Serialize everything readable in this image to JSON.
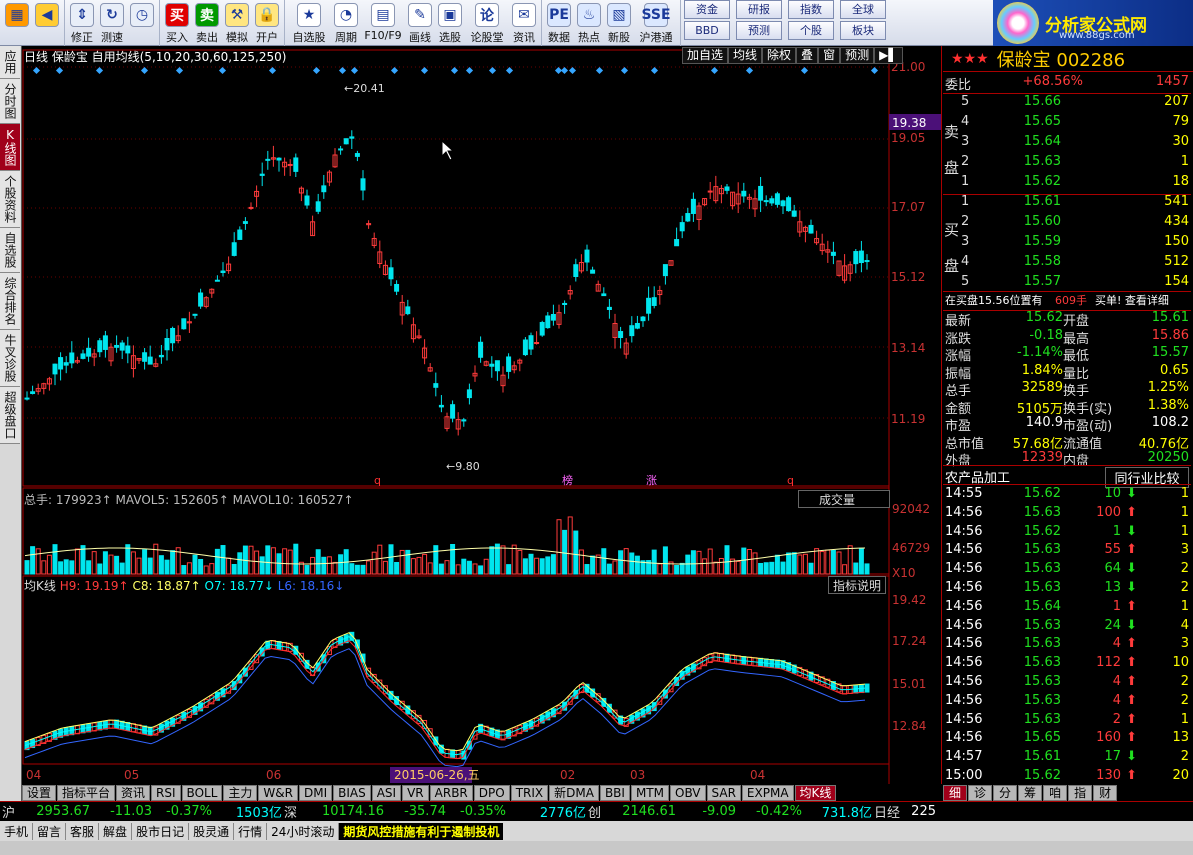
{
  "toolbar": {
    "groups": [
      [
        {
          "label": "",
          "icon": "grid-icon",
          "color": "#ff9900"
        },
        {
          "label": "",
          "icon": "back-arrow-icon",
          "color": "#ffcc33"
        }
      ],
      [
        {
          "label": "修正",
          "icon": "up-down-icon"
        },
        {
          "label": "测速",
          "icon": "refresh-icon"
        },
        {
          "label": "",
          "icon": "clock-icon"
        }
      ],
      [
        {
          "label": "买入",
          "icon": "buy-icon",
          "glyph": "买",
          "color": "#e00000"
        },
        {
          "label": "卖出",
          "icon": "sell-icon",
          "glyph": "卖",
          "color": "#009900"
        },
        {
          "label": "模拟",
          "icon": "hammer-icon"
        },
        {
          "label": "开户",
          "icon": "lock-icon"
        }
      ],
      [
        {
          "label": "自选股",
          "icon": "star-icon"
        },
        {
          "label": "周期",
          "icon": "cycle-icon"
        },
        {
          "label": "F10/F9",
          "icon": "f10-icon"
        },
        {
          "label": "画线",
          "icon": "pen-icon"
        },
        {
          "label": "选股",
          "icon": "select-icon"
        },
        {
          "label": "论股堂",
          "icon": "discuss-icon",
          "glyph": "论"
        },
        {
          "label": "资讯",
          "icon": "news-icon"
        }
      ],
      [
        {
          "label": "数据",
          "icon": "pe-icon",
          "glyph": "PE"
        },
        {
          "label": "热点",
          "icon": "hot-icon"
        },
        {
          "label": "新股",
          "icon": "new-stock-icon"
        },
        {
          "label": "沪港通",
          "icon": "shhk-icon",
          "glyph": "SSE"
        }
      ]
    ],
    "pairs": [
      [
        "资金",
        "BBD"
      ],
      [
        "研报",
        "预测"
      ],
      [
        "指数",
        "个股"
      ],
      [
        "全球",
        "板块"
      ]
    ],
    "logo_text": "分析家公式网",
    "logo_url": "www.88gs.com"
  },
  "sidetabs": [
    {
      "label": "应用",
      "active": false
    },
    {
      "label": "分时图",
      "active": false
    },
    {
      "label": "K线图",
      "active": true
    },
    {
      "label": "个股资料",
      "active": false
    },
    {
      "label": "自选股",
      "active": false
    },
    {
      "label": "综合排名",
      "active": false
    },
    {
      "label": "牛叉诊股",
      "active": false
    },
    {
      "label": "超级盘口",
      "active": false
    }
  ],
  "chart": {
    "title": "日线  保龄宝 自用均线(5,10,20,30,60,125,250)",
    "menu": [
      "加自选",
      "均线",
      "除权",
      "叠",
      "窗",
      "预测",
      "▶▌"
    ],
    "price_labels": [
      "21.00",
      "19.05",
      "17.07",
      "15.12",
      "13.14",
      "11.19"
    ],
    "current_price_label": "19.38",
    "high_label": "20.41",
    "low_label": "9.80",
    "markers": [
      "q",
      "榜",
      "涨",
      "q"
    ],
    "volume_title": "总手: 179923↑  MAVOL5: 152605↑  MAVOL10: 160527↑",
    "volume_select": "成交量",
    "volume_labels": [
      "92042",
      "46729"
    ],
    "volume_unit": "X10",
    "indicator_title_parts": [
      {
        "text": "均K线 ",
        "color": "#dddddd"
      },
      {
        "text": "H9: 19.19↑ ",
        "color": "#ff3b3b"
      },
      {
        "text": "C8: 18.87↑ ",
        "color": "#ffff66"
      },
      {
        "text": "O7: 18.77↓ ",
        "color": "#00ffff"
      },
      {
        "text": "L6: 18.16↓",
        "color": "#3366ff"
      }
    ],
    "indicator_button": "指标说明",
    "indicator_labels": [
      "19.42",
      "17.24",
      "15.01",
      "12.84"
    ],
    "date_labels": [
      "04",
      "05",
      "06",
      "2015-06-26,五",
      "02",
      "03",
      "04"
    ]
  },
  "bottom_tabs": [
    "设置",
    "指标平台",
    "资讯",
    "RSI",
    "BOLL",
    "主力",
    "W&R",
    "DMI",
    "BIAS",
    "ASI",
    "VR",
    "ARBR",
    "DPO",
    "TRIX",
    "新DMA",
    "BBI",
    "MTM",
    "OBV",
    "SAR",
    "EXPMA",
    "均K线"
  ],
  "bottom_tab_active": "均K线",
  "quote": {
    "stock_name": "保龄宝 002286",
    "weibi": {
      "label": "委比",
      "pct": "+68.56%",
      "val": "1457"
    },
    "sell": [
      {
        "lvl": "5",
        "price": "15.66",
        "vol": "207"
      },
      {
        "lvl": "4",
        "price": "15.65",
        "vol": "79"
      },
      {
        "lvl": "3",
        "price": "15.64",
        "vol": "30"
      },
      {
        "lvl": "2",
        "price": "15.63",
        "vol": "1"
      },
      {
        "lvl": "1",
        "price": "15.62",
        "vol": "18"
      }
    ],
    "buy": [
      {
        "lvl": "1",
        "price": "15.61",
        "vol": "541"
      },
      {
        "lvl": "2",
        "price": "15.60",
        "vol": "434"
      },
      {
        "lvl": "3",
        "price": "15.59",
        "vol": "150"
      },
      {
        "lvl": "4",
        "price": "15.58",
        "vol": "512"
      },
      {
        "lvl": "5",
        "price": "15.57",
        "vol": "154"
      }
    ],
    "sell_label": "卖盘",
    "buy_label": "买盘",
    "notice": "在买盘15.56位置有",
    "notice_vol": "609手",
    "notice_tail": "买单! 查看详细",
    "stats": [
      {
        "l1": "最新",
        "v1": "15.62",
        "c1": "grn",
        "l2": "开盘",
        "v2": "15.61",
        "c2": "grn"
      },
      {
        "l1": "涨跌",
        "v1": "-0.18",
        "c1": "grn",
        "l2": "最高",
        "v2": "15.86",
        "c2": "red"
      },
      {
        "l1": "涨幅",
        "v1": "-1.14%",
        "c1": "grn",
        "l2": "最低",
        "v2": "15.57",
        "c2": "grn"
      },
      {
        "l1": "振幅",
        "v1": "1.84%",
        "c1": "yel",
        "l2": "量比",
        "v2": "0.65",
        "c2": "yel"
      },
      {
        "l1": "总手",
        "v1": "32589",
        "c1": "yel",
        "l2": "换手",
        "v2": "1.25%",
        "c2": "yel"
      },
      {
        "l1": "金额",
        "v1": "5105万",
        "c1": "yel",
        "l2": "换手(实)",
        "v2": "1.38%",
        "c2": "yel"
      },
      {
        "l1": "市盈",
        "v1": "140.9",
        "c1": "wht",
        "l2": "市盈(动)",
        "v2": "108.2",
        "c2": "wht"
      },
      {
        "l1": "总市值",
        "v1": "57.68亿",
        "c1": "yel",
        "l2": "流通值",
        "v2": "40.76亿",
        "c2": "yel"
      },
      {
        "l1": "外盘",
        "v1": "12339",
        "c1": "red",
        "l2": "内盘",
        "v2": "20250",
        "c2": "grn"
      }
    ],
    "sector": "农产品加工",
    "sector_btn": "同行业比较",
    "ticks": [
      {
        "t": "14:55",
        "p": "15.62",
        "v": "10",
        "d": "down",
        "n": "1"
      },
      {
        "t": "14:56",
        "p": "15.63",
        "v": "100",
        "d": "up",
        "n": "1"
      },
      {
        "t": "14:56",
        "p": "15.62",
        "v": "1",
        "d": "down",
        "n": "1"
      },
      {
        "t": "14:56",
        "p": "15.63",
        "v": "55",
        "d": "up",
        "n": "3"
      },
      {
        "t": "14:56",
        "p": "15.63",
        "v": "64",
        "d": "down",
        "n": "2"
      },
      {
        "t": "14:56",
        "p": "15.63",
        "v": "13",
        "d": "down",
        "n": "2"
      },
      {
        "t": "14:56",
        "p": "15.64",
        "v": "1",
        "d": "up",
        "n": "1"
      },
      {
        "t": "14:56",
        "p": "15.63",
        "v": "24",
        "d": "down",
        "n": "4"
      },
      {
        "t": "14:56",
        "p": "15.63",
        "v": "4",
        "d": "up",
        "n": "3"
      },
      {
        "t": "14:56",
        "p": "15.63",
        "v": "112",
        "d": "up",
        "n": "10"
      },
      {
        "t": "14:56",
        "p": "15.63",
        "v": "4",
        "d": "up",
        "n": "2"
      },
      {
        "t": "14:56",
        "p": "15.63",
        "v": "4",
        "d": "up",
        "n": "2"
      },
      {
        "t": "14:56",
        "p": "15.63",
        "v": "2",
        "d": "up",
        "n": "1"
      },
      {
        "t": "14:56",
        "p": "15.65",
        "v": "160",
        "d": "up",
        "n": "13"
      },
      {
        "t": "14:57",
        "p": "15.61",
        "v": "17",
        "d": "down",
        "n": "2"
      },
      {
        "t": "15:00",
        "p": "15.62",
        "v": "130",
        "d": "up",
        "n": "20"
      }
    ],
    "rt_tabs": [
      "细",
      "诊",
      "分",
      "筹",
      "咱",
      "指",
      "财"
    ],
    "rt_tab_active": "细"
  },
  "status": {
    "sh_label": "沪",
    "sh_val": "2953.67",
    "sh_chg": "-11.03",
    "sh_pct": "-0.37%",
    "sh_amt": "1503亿",
    "sz_label": "深",
    "sz_val": "10174.16",
    "sz_chg": "-35.74",
    "sz_pct": "-0.35%",
    "sz_amt": "2776亿",
    "cy_label": "创",
    "cy_val": "2146.61",
    "cy_chg": "-9.09",
    "cy_pct": "-0.42%",
    "cy_amt": "731.8亿",
    "rj_label": "日经",
    "rj_val": "225"
  },
  "status2": {
    "items": [
      "手机",
      "留言",
      "客服",
      "解盘",
      "股市日记",
      "股灵通",
      "行情",
      "24小时滚动"
    ],
    "news": "期货风控措施有利于遏制投机"
  },
  "colors": {
    "up": "#ff3b3b",
    "down": "#00e5ee",
    "accent": "#a0001a"
  }
}
